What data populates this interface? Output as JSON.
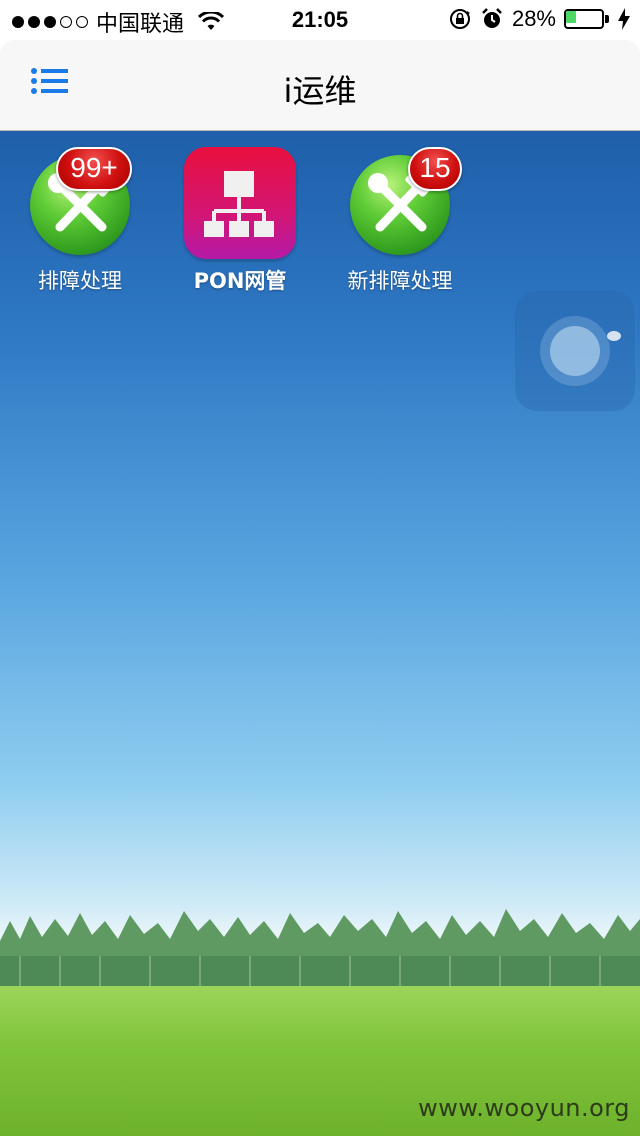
{
  "status_bar": {
    "carrier": "中国联通",
    "time": "21:05",
    "battery_percent": "28%",
    "battery_level": 0.28,
    "icons": [
      "signal-dots",
      "wifi-icon",
      "rotation-lock-icon",
      "alarm-icon",
      "battery-icon",
      "charging-bolt-icon"
    ]
  },
  "nav": {
    "title": "i运维",
    "menu_icon": "list-menu-icon",
    "accent": "#1a7be8"
  },
  "apps": [
    {
      "label": "排障处理",
      "badge": "99+",
      "icon": "tools-icon"
    },
    {
      "label": "PON网管",
      "badge": "",
      "icon": "network-topology-icon"
    },
    {
      "label": "新排障处理",
      "badge": "15",
      "icon": "tools-icon"
    }
  ],
  "watermark": "www.wooyun.org"
}
